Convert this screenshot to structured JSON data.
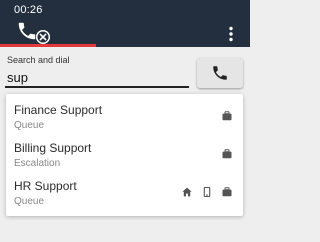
{
  "header": {
    "call_timer": "00:26",
    "status_icon": "phone-icon",
    "end_call_icon": "end-call-icon",
    "menu_icon": "more-vertical-icon",
    "background_color": "#232f3e",
    "accent_color": "#e3393a"
  },
  "search": {
    "label": "Search and dial",
    "value": "sup",
    "dial_icon": "phone-icon"
  },
  "results": [
    {
      "name": "Finance Support",
      "type": "Queue",
      "icons": [
        "briefcase-icon"
      ]
    },
    {
      "name": "Billing Support",
      "type": "Escalation",
      "icons": [
        "briefcase-icon"
      ]
    },
    {
      "name": "HR Support",
      "type": "Queue",
      "icons": [
        "home-icon",
        "mobile-icon",
        "briefcase-icon"
      ]
    }
  ]
}
